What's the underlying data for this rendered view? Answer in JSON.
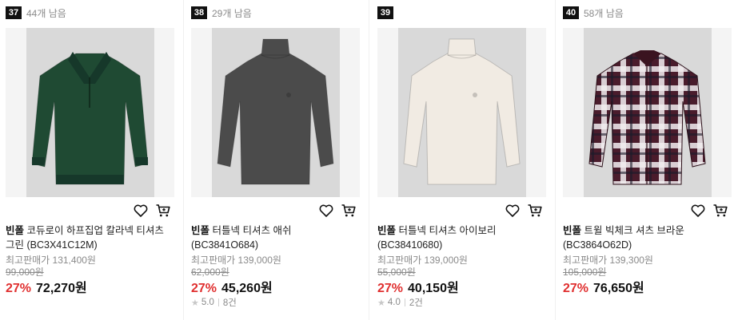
{
  "products": [
    {
      "rank": "37",
      "remaining": "44개 남음",
      "brand": "빈폴",
      "name": "코듀로이 하프집업 칼라넥 티셔츠 그린 (BC3X41C12M)",
      "original_label": "최고판매가 131,400원",
      "list_price": "99,000원",
      "discount": "27%",
      "price": "72,270원",
      "rating": "",
      "reviews": "",
      "garment_color": "#1f4a33",
      "style": "halfzip"
    },
    {
      "rank": "38",
      "remaining": "29개 남음",
      "brand": "빈폴",
      "name": "터틀넥 티셔츠 애쉬 (BC3841O684)",
      "original_label": "최고판매가 139,000원",
      "list_price": "62,000원",
      "discount": "27%",
      "price": "45,260원",
      "rating": "5.0",
      "reviews": "8건",
      "garment_color": "#4b4b4b",
      "style": "turtleneck"
    },
    {
      "rank": "39",
      "remaining": "",
      "brand": "빈폴",
      "name": "터틀넥 티셔츠 아이보리 (BC38410680)",
      "original_label": "최고판매가 139,000원",
      "list_price": "55,000원",
      "discount": "27%",
      "price": "40,150원",
      "rating": "4.0",
      "reviews": "2건",
      "garment_color": "#f1ebe3",
      "style": "turtleneck"
    },
    {
      "rank": "40",
      "remaining": "58개 남음",
      "brand": "빈폴",
      "name": "트윌 빅체크 셔츠 브라운 (BC3864O62D)",
      "original_label": "최고판매가 139,300원",
      "list_price": "105,000원",
      "discount": "27%",
      "price": "76,650원",
      "rating": "",
      "reviews": "",
      "garment_color": "#4a1c2c",
      "style": "check"
    }
  ],
  "colors": {
    "discount": "#e03030",
    "rank_badge": "#111111",
    "muted": "#8a8a8a"
  },
  "icons": {
    "wishlist": "heart-icon",
    "cart": "cart-icon",
    "rating": "star-icon"
  }
}
